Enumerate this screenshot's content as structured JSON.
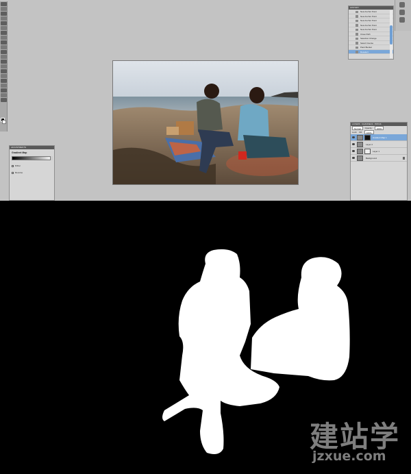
{
  "history": {
    "title": "HISTORY",
    "items": [
      "New Anchor Point",
      "New Anchor Point",
      "New Anchor Point",
      "New Anchor Point",
      "New Anchor Point",
      "Close Path",
      "Selection Change",
      "Select Inverse",
      "Paint Bucket",
      "Deselect"
    ],
    "active_index": 9
  },
  "adjustments": {
    "title": "ADJUSTMENTS",
    "name": "Gradient Map",
    "option_dither": "Dither",
    "option_reverse": "Reverse"
  },
  "layers": {
    "title": "LAYERS",
    "tab2": "CHANNELS",
    "tab3": "PATHS",
    "blend_mode": "Normal",
    "opacity_label": "Opacity:",
    "opacity_value": "100%",
    "lock_label": "Lock:",
    "fill_label": "Fill:",
    "fill_value": "100%",
    "rows": [
      {
        "name": "Gradient Map 1"
      },
      {
        "name": "Layer 2"
      },
      {
        "name": "Layer 1"
      },
      {
        "name": "Background"
      }
    ]
  },
  "watermark": {
    "logo": "建站学",
    "url": "jzxue.com"
  },
  "colors": {
    "workspace": "#c3c3c3",
    "panel": "#d6d6d6",
    "selection": "#7aa7d9",
    "mask_bg": "#000000",
    "mask_fg": "#ffffff"
  },
  "icons": {
    "toolbox": "tool-icons",
    "minibar": "panel-icons"
  }
}
